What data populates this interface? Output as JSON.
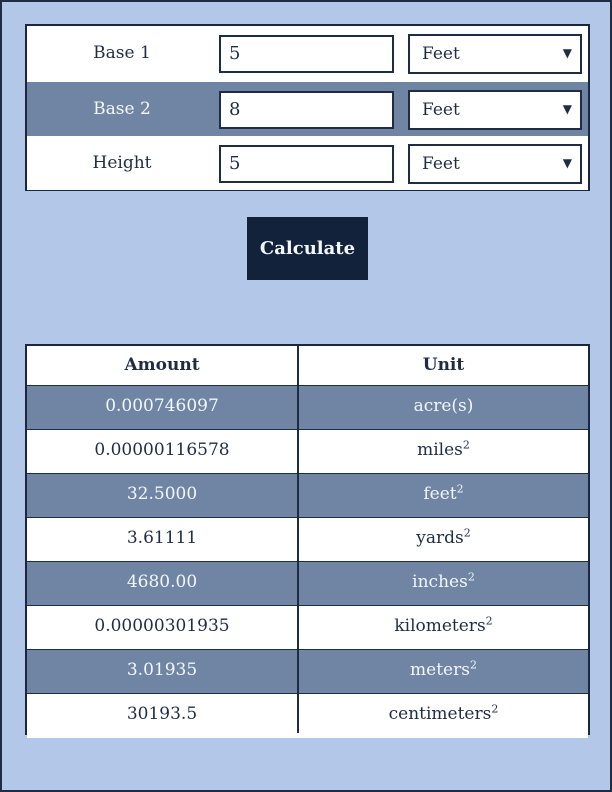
{
  "inputs": [
    {
      "label": "Base 1",
      "value": "5",
      "unit": "Feet"
    },
    {
      "label": "Base 2",
      "value": "8",
      "unit": "Feet"
    },
    {
      "label": "Height",
      "value": "5",
      "unit": "Feet"
    }
  ],
  "caret_glyph": "▼",
  "calculate_label": "Calculate",
  "results": {
    "headers": {
      "amount": "Amount",
      "unit": "Unit"
    },
    "superscript": "2",
    "rows": [
      {
        "amount": "0.000746097",
        "unit": "acre(s)",
        "squared": false
      },
      {
        "amount": "0.00000116578",
        "unit": "miles",
        "squared": true
      },
      {
        "amount": "32.5000",
        "unit": "feet",
        "squared": true
      },
      {
        "amount": "3.61111",
        "unit": "yards",
        "squared": true
      },
      {
        "amount": "4680.00",
        "unit": "inches",
        "squared": true
      },
      {
        "amount": "0.00000301935",
        "unit": "kilometers",
        "squared": true
      },
      {
        "amount": "3.01935",
        "unit": "meters",
        "squared": true
      },
      {
        "amount": "30193.5",
        "unit": "centimeters",
        "squared": true
      }
    ]
  }
}
